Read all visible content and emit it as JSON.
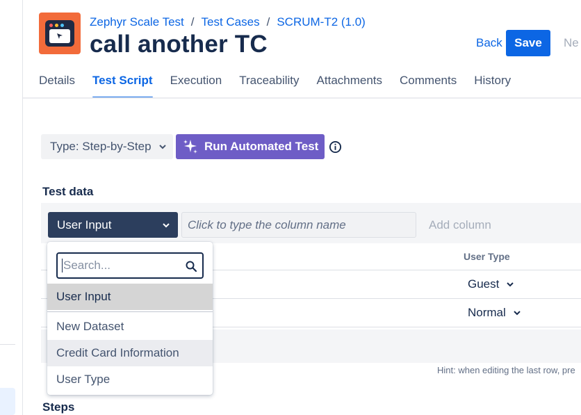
{
  "colors": {
    "primary": "#0c66e4",
    "automation_purple": "#6e5dc6",
    "dataset_select_bg": "#2c3e5d",
    "app_logo_bg": "#f26b3a"
  },
  "header": {
    "app_icon": "zephyr-scale-logo-icon",
    "breadcrumb": [
      "Zephyr Scale Test",
      "Test Cases",
      "SCRUM-T2 (1.0)"
    ],
    "breadcrumb_separator": "/",
    "title": "call another TC",
    "actions": {
      "back": "Back",
      "save": "Save",
      "next": "Ne"
    }
  },
  "tabs": [
    {
      "label": "Details",
      "active": false
    },
    {
      "label": "Test Script",
      "active": true
    },
    {
      "label": "Execution",
      "active": false
    },
    {
      "label": "Traceability",
      "active": false
    },
    {
      "label": "Attachments",
      "active": false
    },
    {
      "label": "Comments",
      "active": false
    },
    {
      "label": "History",
      "active": false
    }
  ],
  "script": {
    "type_select": "Type: Step-by-Step",
    "run_automated": "Run Automated Test",
    "run_icon": "sparkles-icon",
    "info_icon": "info-icon"
  },
  "test_data": {
    "section_title": "Test data",
    "dataset_selected": "User Input",
    "column_placeholder": "Click to type the column name",
    "add_column": "Add column",
    "column_header": "User Type",
    "rows": [
      "Guest",
      "Normal"
    ],
    "hint": "Hint: when editing the last row, pre"
  },
  "dataset_dropdown": {
    "search_placeholder": "Search...",
    "selected_item": "User Input",
    "items": [
      "New Dataset",
      "Credit Card Information",
      "User Type"
    ]
  },
  "steps": {
    "section_title": "Steps"
  }
}
